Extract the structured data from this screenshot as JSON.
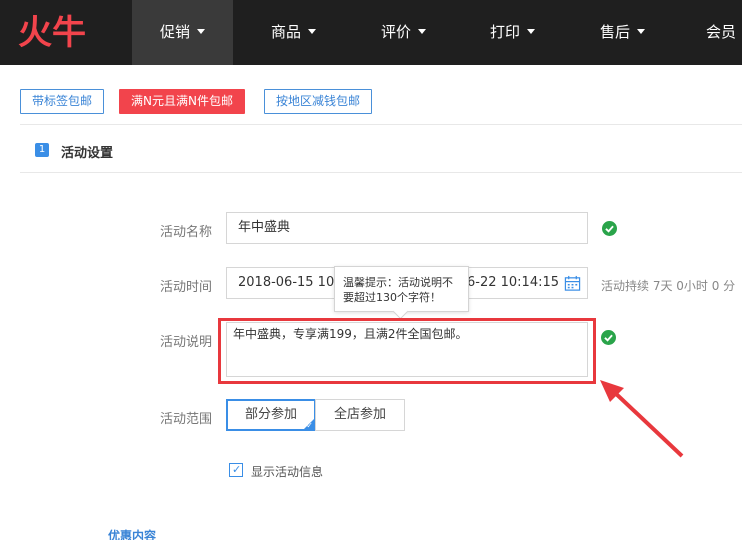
{
  "logo": {
    "text": "火牛",
    "color": "#f2444c"
  },
  "nav": {
    "items": [
      {
        "label": "促销",
        "active": true,
        "caret": true
      },
      {
        "label": "商品",
        "active": false,
        "caret": true
      },
      {
        "label": "评价",
        "active": false,
        "caret": true
      },
      {
        "label": "打印",
        "active": false,
        "caret": true
      },
      {
        "label": "售后",
        "active": false,
        "caret": true
      },
      {
        "label": "会员",
        "active": false,
        "caret": false
      }
    ]
  },
  "mode_tabs": [
    {
      "label": "带标签包邮",
      "active": false
    },
    {
      "label": "满N元且满N件包邮",
      "active": true
    },
    {
      "label": "按地区减钱包邮",
      "active": false
    }
  ],
  "section": {
    "number": "1",
    "title": "活动设置"
  },
  "form": {
    "name": {
      "label": "活动名称",
      "value": "年中盛典",
      "valid": true
    },
    "time": {
      "label": "活动时间",
      "start": "2018-06-15 10:1",
      "end": "6-22 10:14:15",
      "duration": "活动持续 7天 0小时 0 分"
    },
    "description": {
      "label": "活动说明",
      "value": "年中盛典，专享满199，且满2件全国包邮。",
      "valid": true
    },
    "tooltip": {
      "text": "温馨提示：活动说明不要超过130个字符！"
    },
    "scope": {
      "label": "活动范围",
      "options": [
        {
          "label": "部分参加",
          "selected": true
        },
        {
          "label": "全店参加",
          "selected": false
        }
      ]
    },
    "show_info": {
      "label": "显示活动信息",
      "checked": true
    }
  },
  "footer": {
    "link": "优惠内容"
  },
  "colors": {
    "accent": "#3a8ee6",
    "brand": "#f2444c",
    "success": "#2aa44a",
    "annotation": "#e8383d"
  }
}
